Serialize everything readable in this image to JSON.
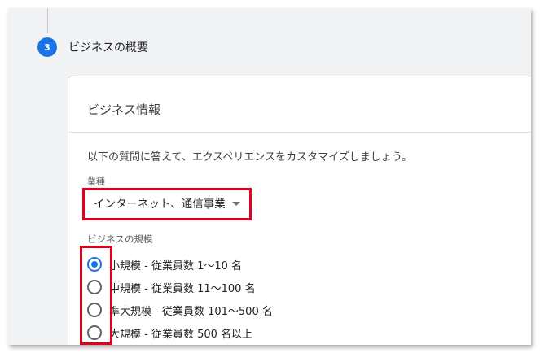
{
  "step": {
    "number": "3",
    "title": "ビジネスの概要"
  },
  "card": {
    "title": "ビジネス情報",
    "intro": "以下の質問に答えて、エクスペリエンスをカスタマイズしましょう。"
  },
  "industry": {
    "label": "業種",
    "selected": "インターネット、通信事業"
  },
  "business_size": {
    "label": "ビジネスの規模",
    "options": [
      {
        "label": "小規模 - 従業員数 1〜10 名",
        "checked": true
      },
      {
        "label": "中規模 - 従業員数 11〜100 名",
        "checked": false
      },
      {
        "label": "準大規模 - 従業員数 101〜500 名",
        "checked": false
      },
      {
        "label": "大規模 - 従業員数 500 名以上",
        "checked": false
      }
    ]
  },
  "colors": {
    "accent": "#1a73e8",
    "highlight": "#e0001b"
  }
}
